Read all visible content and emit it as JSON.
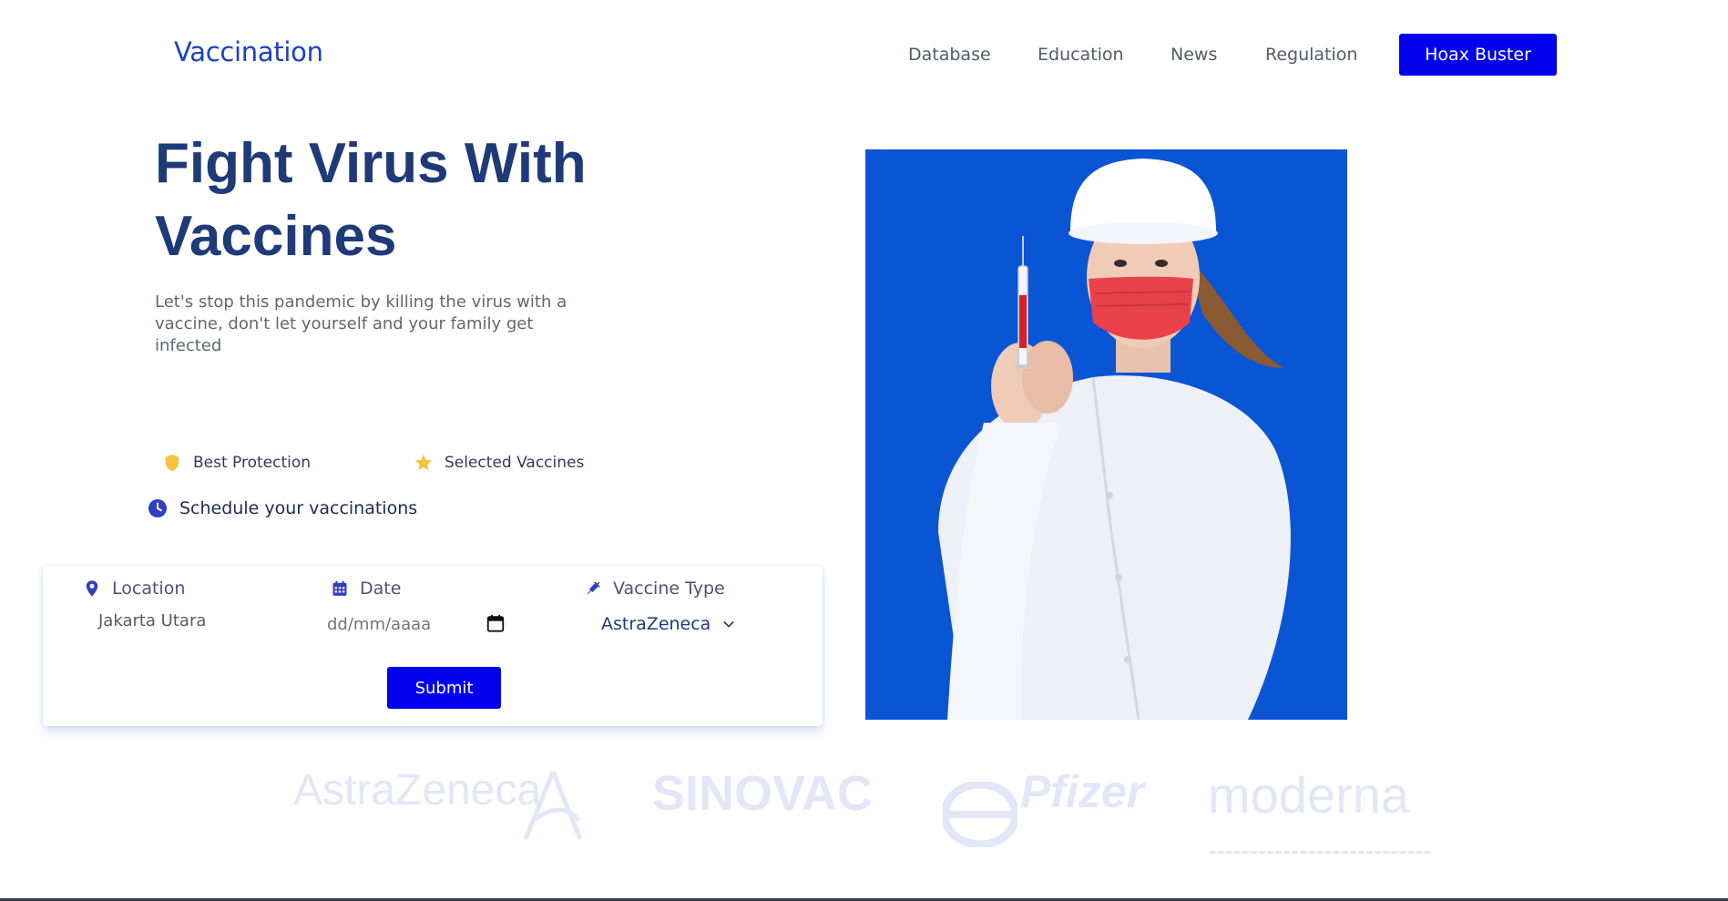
{
  "header": {
    "logo": "Vaccination",
    "nav": [
      "Database",
      "Education",
      "News",
      "Regulation"
    ],
    "cta": "Hoax Buster"
  },
  "hero": {
    "title_line1": "Fight Virus With",
    "title_line2": "Vaccines",
    "subtitle": "Let's stop this pandemic by killing the virus with a vaccine, don't let yourself and your family get infected"
  },
  "features": [
    {
      "label": "Best Protection",
      "icon": "shield-icon"
    },
    {
      "label": "Selected Vaccines",
      "icon": "star-icon"
    }
  ],
  "schedule": {
    "label": "Schedule your vaccinations",
    "icon": "clock-icon"
  },
  "form": {
    "location_label": "Location",
    "location_value": "Jakarta Utara",
    "date_label": "Date",
    "date_placeholder": "dd/mm/aaaa",
    "vaccine_label": "Vaccine Type",
    "vaccine_value": "AstraZeneca",
    "submit": "Submit"
  },
  "brands": [
    "AstraZeneca",
    "SINOVAC",
    "Pfizer",
    "moderna"
  ],
  "colors": {
    "primary": "#0000ee",
    "brand_blue": "#1d3fc8",
    "title_navy": "#1e3a78",
    "icon_yellow": "#f6c343",
    "image_bg": "#0a55d4",
    "brand_logo_gray": "#e3e6f6"
  }
}
